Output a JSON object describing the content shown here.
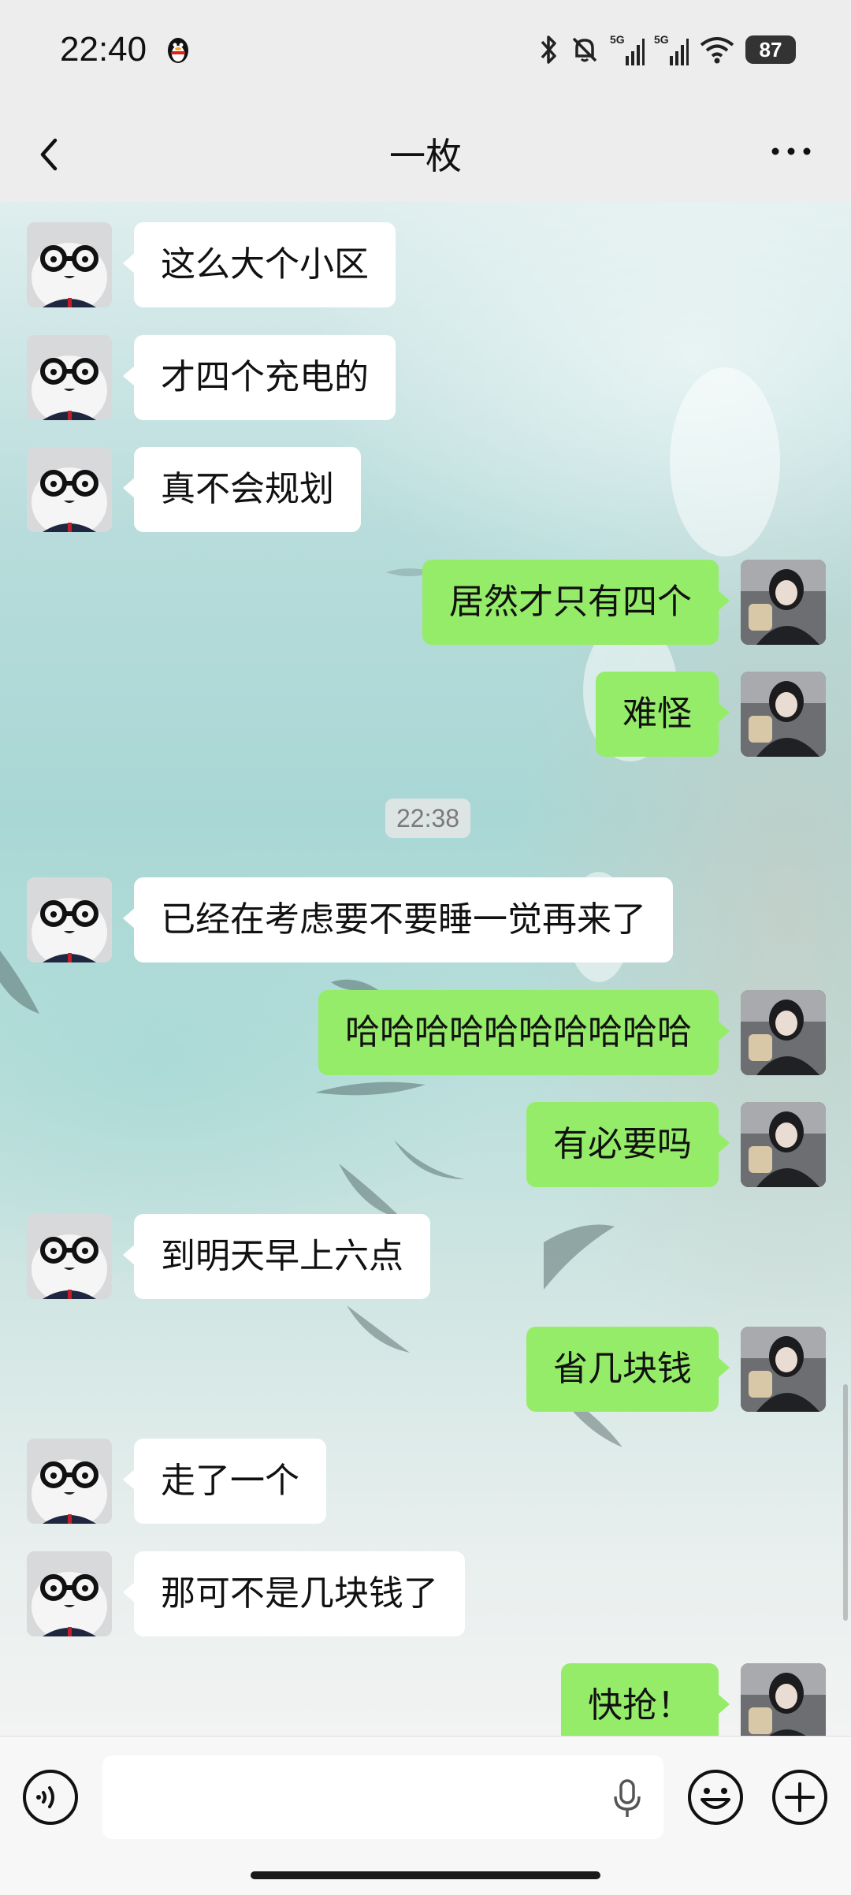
{
  "status_bar": {
    "time": "22:40",
    "network_labels": [
      "5G",
      "5G"
    ],
    "battery": "87",
    "icons": [
      "qq-penguin-icon",
      "bluetooth-icon",
      "mute-bell-icon",
      "signal-icon",
      "signal-icon",
      "wifi-icon",
      "battery-icon"
    ]
  },
  "header": {
    "title": "一枚"
  },
  "messages": [
    {
      "side": "in",
      "text": "这么大个小区"
    },
    {
      "side": "in",
      "text": "才四个充电的"
    },
    {
      "side": "in",
      "text": "真不会规划"
    },
    {
      "side": "out",
      "text": "居然才只有四个"
    },
    {
      "side": "out",
      "text": "难怪"
    },
    {
      "side": "in",
      "text": "已经在考虑要不要睡一觉再来了"
    },
    {
      "side": "out",
      "text": "哈哈哈哈哈哈哈哈哈哈"
    },
    {
      "side": "out",
      "text": "有必要吗"
    },
    {
      "side": "in",
      "text": "到明天早上六点"
    },
    {
      "side": "out",
      "text": "省几块钱"
    },
    {
      "side": "in",
      "text": "走了一个"
    },
    {
      "side": "in",
      "text": "那可不是几块钱了"
    },
    {
      "side": "out",
      "text": "快抢！"
    }
  ],
  "timestamp": "22:38",
  "input": {
    "placeholder": ""
  },
  "colors": {
    "outgoing_bubble": "#95ec69",
    "incoming_bubble": "#ffffff",
    "bar_background": "#ededed"
  }
}
